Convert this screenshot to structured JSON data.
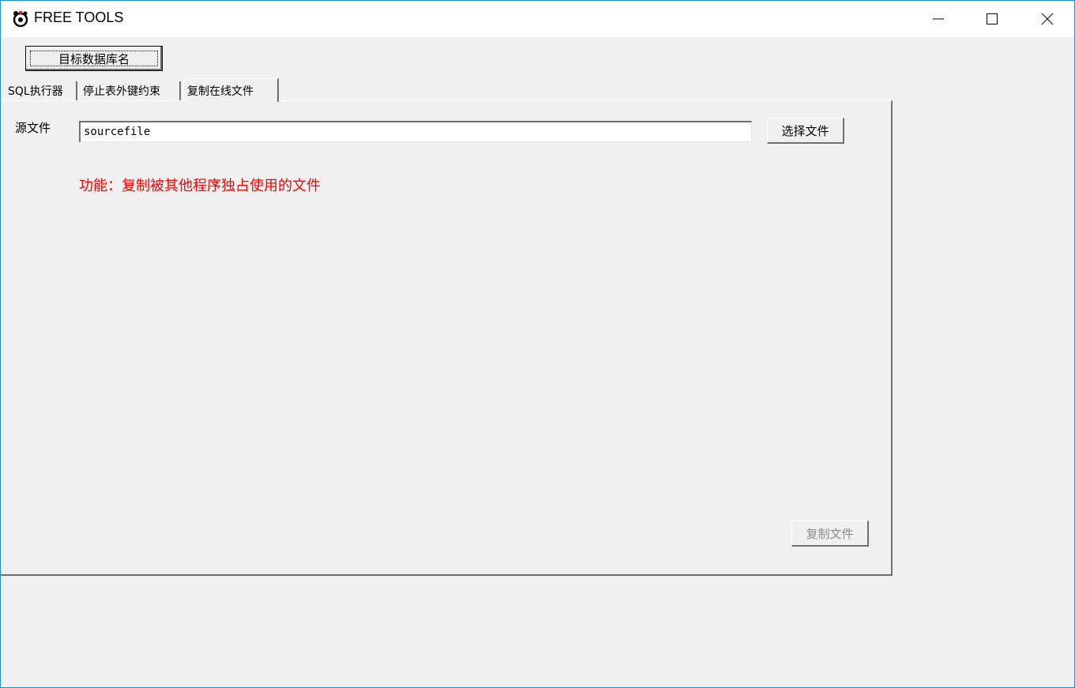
{
  "window": {
    "title": "FREE TOOLS"
  },
  "toolbar": {
    "target_db_label": "目标数据库名"
  },
  "tabs": [
    {
      "label": "SQL执行器",
      "selected": false
    },
    {
      "label": "停止表外键约束",
      "selected": false
    },
    {
      "label": "复制在线文件",
      "selected": true
    }
  ],
  "copy_tab": {
    "source_label": "源文件",
    "source_value": "sourcefile",
    "choose_button": "选择文件",
    "feature_text": "功能：复制被其他程序独占使用的文件",
    "copy_button": "复制文件",
    "copy_button_enabled": false
  },
  "colors": {
    "feature_text": "#ff0000",
    "disabled_text": "#8a8a8a"
  }
}
